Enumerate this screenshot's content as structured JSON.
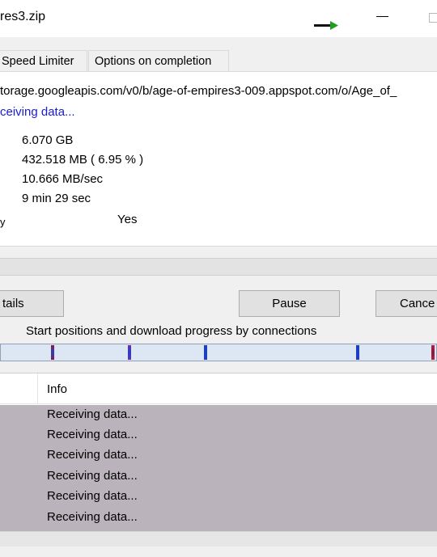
{
  "window": {
    "title": "res3.zip"
  },
  "tabs": [
    {
      "label": "Speed Limiter"
    },
    {
      "label": "Options on completion"
    }
  ],
  "info": {
    "url": "torage.googleapis.com/v0/b/age-of-empires3-009.appspot.com/o/Age_of_",
    "status": "ceiving data...",
    "file_size": "6.070  GB",
    "downloaded": "432.518  MB  ( 6.95 % )",
    "transfer_rate": "10.666  MB/sec",
    "time_left": "9 min 29 sec",
    "resume_label_fragment": "y",
    "resume_capability": "Yes"
  },
  "buttons": {
    "details": "tails",
    "pause": "Pause",
    "cancel": "Cance"
  },
  "connections": {
    "caption": "Start positions and download progress by connections",
    "markers": [
      {
        "color": "#2b3fc0",
        "accent": "#8a1a4a"
      },
      {
        "color": "#2b3fc0",
        "accent": "#6a2cc0"
      },
      {
        "color": "#1a3fc0",
        "accent": "#1a3fc0"
      },
      {
        "color": "#1a3fc0",
        "accent": "#1a3fc0"
      },
      {
        "color": "#8a1a3a",
        "accent": "#c01a3a"
      }
    ]
  },
  "log": {
    "column_info": "Info",
    "rows": [
      {
        "info": "Receiving data..."
      },
      {
        "info": "Receiving data..."
      },
      {
        "info": "Receiving data..."
      },
      {
        "info": "Receiving data..."
      },
      {
        "info": "Receiving data..."
      },
      {
        "info": "Receiving data..."
      }
    ]
  },
  "colors": {
    "status_text": "#1a1ad8",
    "arrow": "#1ea01e",
    "log_row_bg": "#bbb3bb",
    "connection_bar_bg": "#dde6f3"
  }
}
